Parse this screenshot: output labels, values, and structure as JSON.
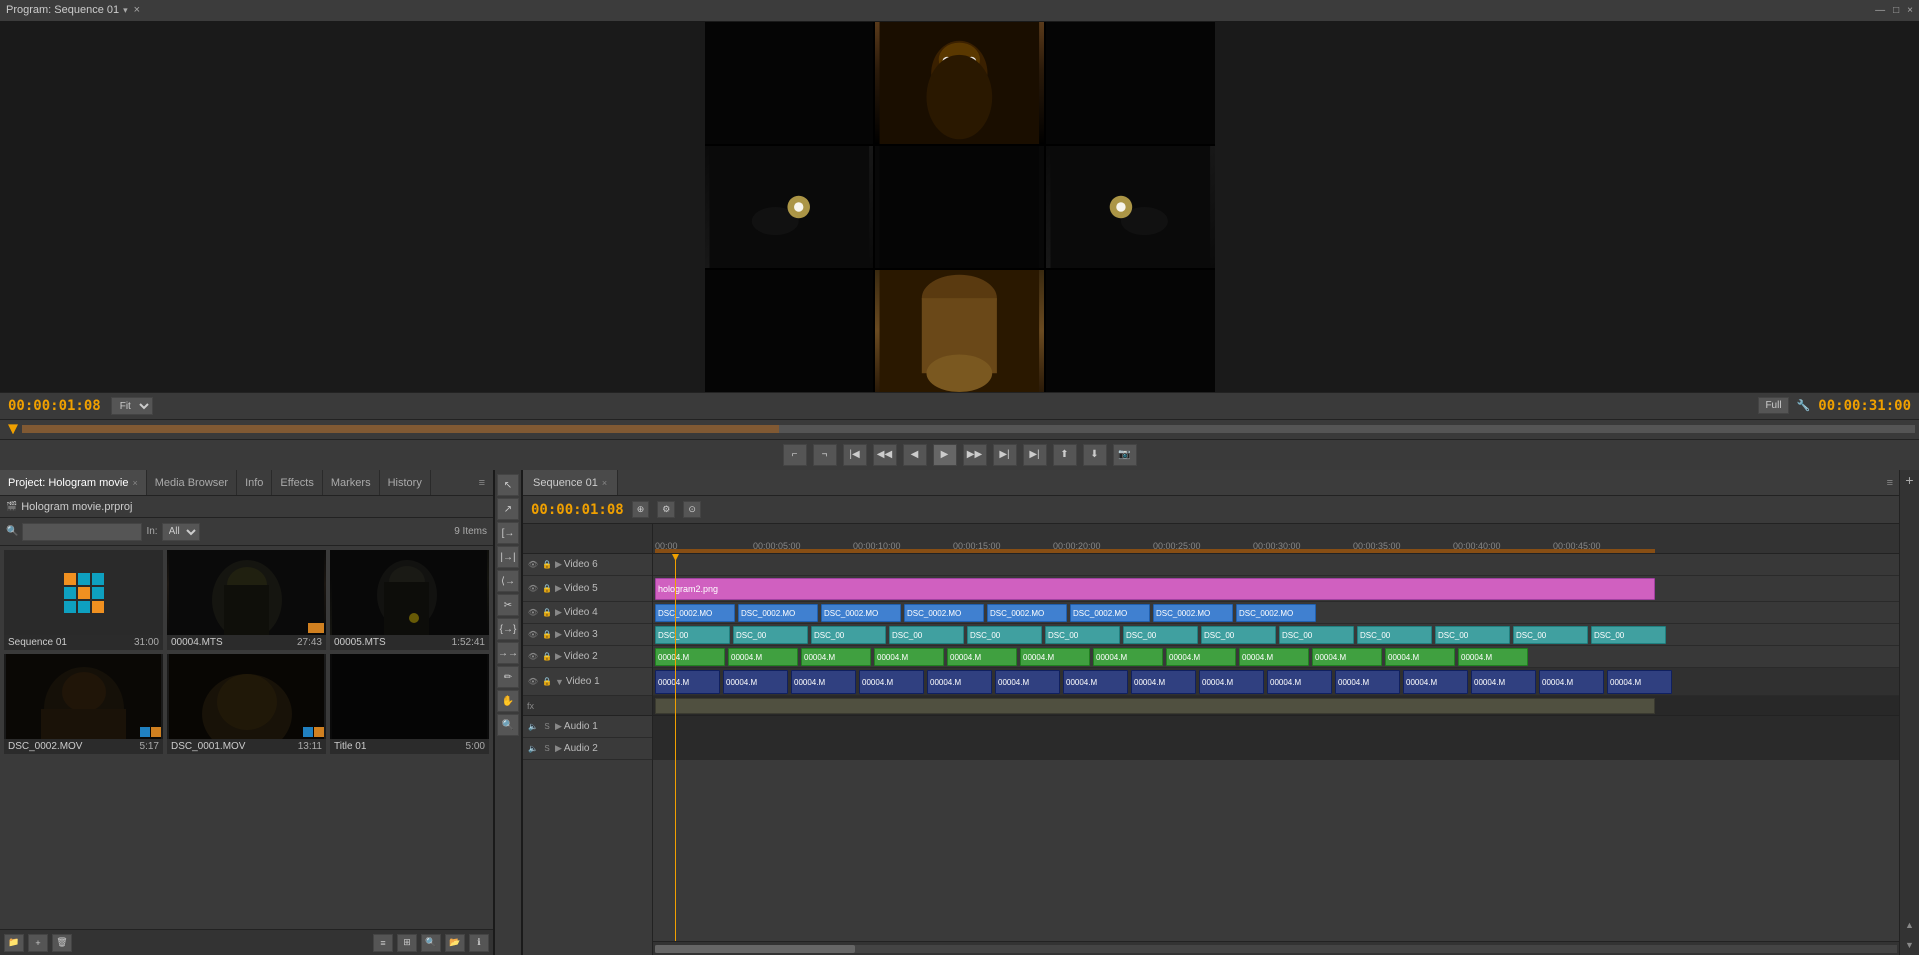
{
  "app": {
    "title": "Program: Sequence 01",
    "close_btn": "×"
  },
  "program_monitor": {
    "title": "Program: Sequence 01",
    "timecode_current": "00:00:01:08",
    "timecode_total": "00:00:31:00",
    "fit_label": "Fit",
    "full_label": "Full"
  },
  "project_panel": {
    "tabs": [
      {
        "label": "Project: Hologram movie",
        "active": true,
        "closable": true
      },
      {
        "label": "Media Browser",
        "active": false
      },
      {
        "label": "Info",
        "active": false
      },
      {
        "label": "Effects",
        "active": false
      },
      {
        "label": "Markers",
        "active": false
      },
      {
        "label": "History",
        "active": false
      }
    ],
    "search_placeholder": "",
    "in_label": "In:",
    "in_value": "All",
    "items_count": "9 Items",
    "project_name": "Hologram movie.prproj",
    "thumbnails": [
      {
        "name": "Sequence 01",
        "duration": "31:00",
        "type": "sequence"
      },
      {
        "name": "00004.MTS",
        "duration": "27:43",
        "type": "video"
      },
      {
        "name": "00005.MTS",
        "duration": "1:52:41",
        "type": "video"
      },
      {
        "name": "DSC_0002.MOV",
        "duration": "5:17",
        "type": "video"
      },
      {
        "name": "DSC_0001.MOV",
        "duration": "13:11",
        "type": "video"
      },
      {
        "name": "Title 01",
        "duration": "5:00",
        "type": "title"
      }
    ]
  },
  "timeline": {
    "tab_label": "Sequence 01",
    "timecode": "00:00:01:08",
    "ruler_marks": [
      "00:00",
      "00:00:05:00",
      "00:00:10:00",
      "00:00:15:00",
      "00:00:20:00",
      "00:00:25:00",
      "00:00:30:00",
      "00:00:35:00",
      "00:00:40:00",
      "00:00:45:00"
    ],
    "tracks": [
      {
        "name": "Video 6",
        "type": "video"
      },
      {
        "name": "Video 5",
        "type": "video"
      },
      {
        "name": "Video 4",
        "type": "video"
      },
      {
        "name": "Video 3",
        "type": "video"
      },
      {
        "name": "Video 2",
        "type": "video"
      },
      {
        "name": "Video 1",
        "type": "video"
      },
      {
        "name": "Audio 1",
        "type": "audio"
      },
      {
        "name": "Audio 2",
        "type": "audio"
      }
    ],
    "clips": {
      "video5_clip": "hologram2.png",
      "video4_clips": "DSC_0002.MO",
      "video3_clips": "DSC_00",
      "video2_clips": "00004.M",
      "video1_clips": "00004.M"
    }
  },
  "transport": {
    "buttons": [
      "mark-in",
      "mark-out",
      "goto-in",
      "prev-edit",
      "play-reverse",
      "play",
      "play-forward",
      "next-edit",
      "goto-out",
      "lift",
      "extract",
      "export-frame"
    ]
  },
  "tools": {
    "icons": [
      "select",
      "track-select",
      "ripple",
      "rolling",
      "rate-stretch",
      "razor",
      "slip",
      "slide",
      "pen",
      "hand",
      "zoom"
    ]
  }
}
